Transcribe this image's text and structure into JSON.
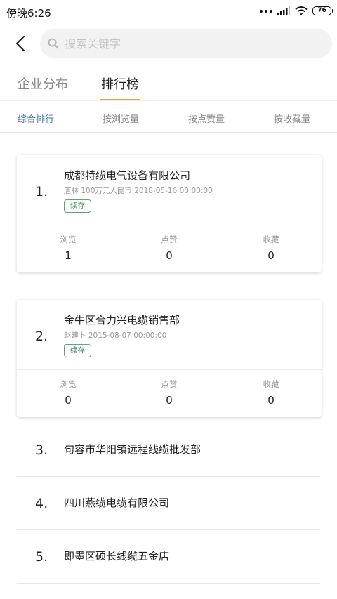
{
  "status_bar": {
    "time": "傍晚6:26",
    "battery": "76"
  },
  "header": {
    "search_placeholder": "搜索关键字"
  },
  "main_tabs": [
    {
      "label": "企业分布",
      "active": false
    },
    {
      "label": "排行榜",
      "active": true
    }
  ],
  "sub_tabs": [
    {
      "label": "综合排行",
      "active": true
    },
    {
      "label": "按浏览量",
      "active": false
    },
    {
      "label": "按点赞量",
      "active": false
    },
    {
      "label": "按收藏量",
      "active": false
    }
  ],
  "cards": [
    {
      "rank": "1.",
      "name": "成都特缆电气设备有限公司",
      "meta": "唐林 100万元人民币 2018-05-16 00:00:00",
      "badge": "续存",
      "stats": [
        {
          "label": "浏览",
          "value": "1"
        },
        {
          "label": "点赞",
          "value": "0"
        },
        {
          "label": "收藏",
          "value": "0"
        }
      ]
    },
    {
      "rank": "2.",
      "name": "金牛区合力兴电缆销售部",
      "meta": "赵建卜 2015-08-07 00:00:00",
      "badge": "续存",
      "stats": [
        {
          "label": "浏览",
          "value": "0"
        },
        {
          "label": "点赞",
          "value": "0"
        },
        {
          "label": "收藏",
          "value": "0"
        }
      ]
    }
  ],
  "list": [
    {
      "rank": "3.",
      "name": "句容市华阳镇远程线缆批发部"
    },
    {
      "rank": "4.",
      "name": "四川燕缆电缆有限公司"
    },
    {
      "rank": "5.",
      "name": "即墨区硕长线缆五金店"
    }
  ],
  "colors": {
    "accent": "#e2a348",
    "active_subtab": "#4a7aa8",
    "badge": "#3d8a5c"
  }
}
